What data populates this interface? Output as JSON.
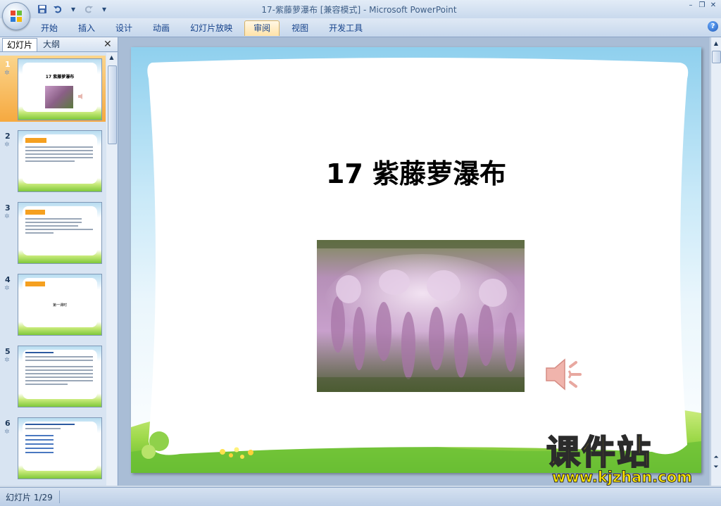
{
  "window": {
    "title": "17-紫藤萝瀑布 [兼容模式] - Microsoft PowerPoint"
  },
  "qat": {
    "save_icon": "save-icon",
    "undo_icon": "undo-icon",
    "redo_icon": "redo-icon",
    "customize_icon": "customize-qat-icon"
  },
  "ribbon": {
    "tabs": [
      {
        "label": "开始",
        "active": false
      },
      {
        "label": "插入",
        "active": false
      },
      {
        "label": "设计",
        "active": false
      },
      {
        "label": "动画",
        "active": false
      },
      {
        "label": "幻灯片放映",
        "active": false
      },
      {
        "label": "审阅",
        "active": true
      },
      {
        "label": "视图",
        "active": false
      },
      {
        "label": "开发工具",
        "active": false
      }
    ],
    "help_icon": "help-icon"
  },
  "panel": {
    "tab_slides": "幻灯片",
    "tab_outline": "大纲",
    "close_glyph": "✕",
    "thumbnails": [
      {
        "num": "1",
        "selected": true
      },
      {
        "num": "2",
        "selected": false
      },
      {
        "num": "3",
        "selected": false
      },
      {
        "num": "4",
        "selected": false
      },
      {
        "num": "5",
        "selected": false
      },
      {
        "num": "6",
        "selected": false
      }
    ],
    "thumb1_title": "17 紫藤萝瀑布",
    "thumb4_center": "第一课时"
  },
  "slide": {
    "title": "17 紫藤萝瀑布",
    "photo_icon": "wisteria-photo",
    "sound_icon": "speaker-icon"
  },
  "watermark": {
    "text": "课件站",
    "url": "www.kjzhan.com"
  },
  "status": {
    "slide_info": "幻灯片 1/29"
  },
  "colors": {
    "ribbon_bg": "#c6d7ec",
    "active_tab": "#ffe3a8",
    "selected_thumb": "#f6a940",
    "slide_sky": "#8fd0ee",
    "slide_grass": "#7fc83a",
    "watermark": "#ffe600"
  }
}
